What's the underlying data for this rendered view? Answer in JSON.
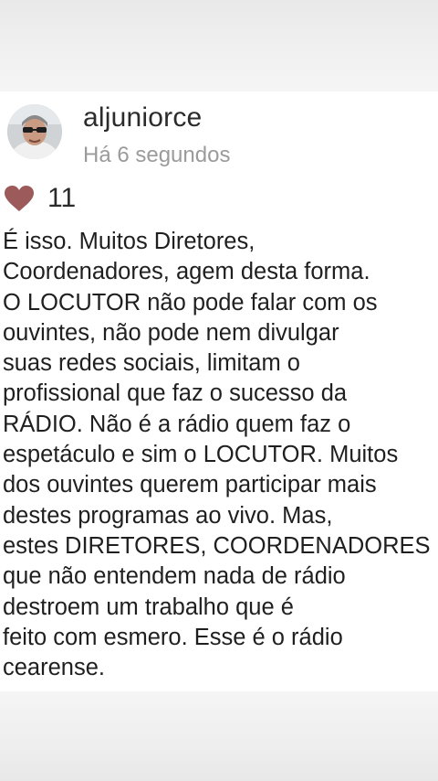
{
  "post": {
    "username": "aljuniorce",
    "timestamp": "Há 6 segundos",
    "likes": "11",
    "colors": {
      "heart": "#9c5a5a",
      "username": "#2b2b2b",
      "timestamp": "#9b9b9b"
    },
    "icons": {
      "like": "heart-icon",
      "avatar": "user-avatar"
    },
    "comment_lines": [
      "É isso. Muitos Diretores,",
      "Coordenadores, agem desta forma.",
      "O LOCUTOR não pode falar com os",
      "ouvintes, não pode nem divulgar",
      "suas redes sociais, limitam o",
      "profissional que faz o sucesso da",
      "RÁDIO. Não é a rádio quem faz o",
      "espetáculo e sim o LOCUTOR. Muitos",
      "dos ouvintes querem participar mais",
      "destes programas ao vivo. Mas,",
      "estes DIRETORES, COORDENADORES",
      "que não entendem nada de rádio",
      "destroem um trabalho que é",
      "feito com esmero. Esse é o rádio",
      "cearense."
    ]
  }
}
